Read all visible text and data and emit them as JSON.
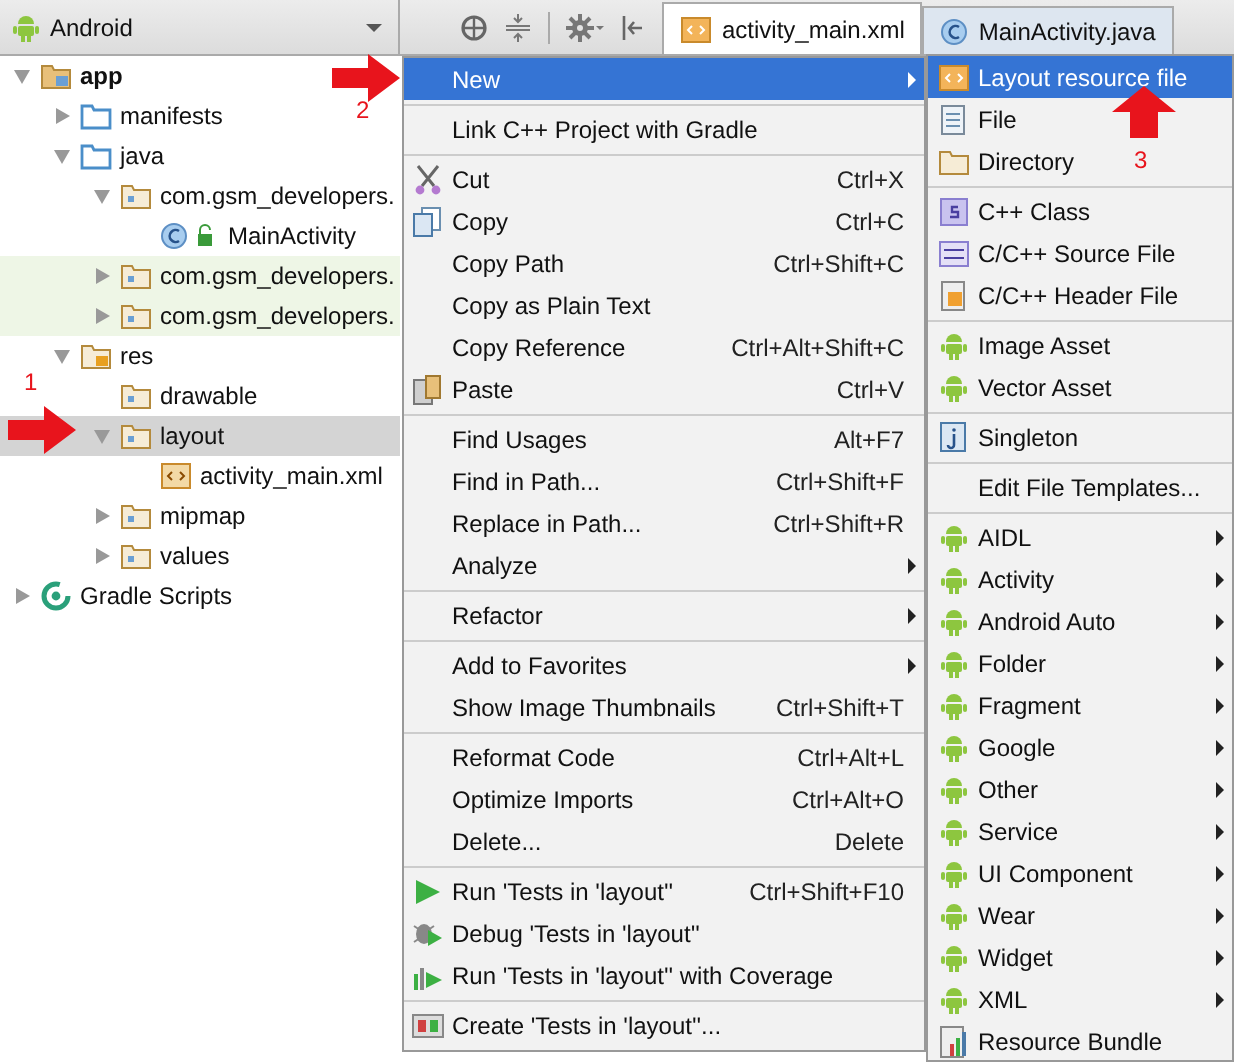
{
  "toolbar": {
    "view_selector": "Android",
    "tabs": [
      {
        "label": "activity_main.xml",
        "kind": "xml",
        "selected": true
      },
      {
        "label": "MainActivity.java",
        "kind": "class",
        "selected": false
      }
    ]
  },
  "project_tree": [
    {
      "label": "app",
      "kind": "module",
      "expanded": true,
      "selected": false,
      "highlighted": false,
      "children": [
        {
          "label": "manifests",
          "kind": "folder",
          "expanded": false,
          "selected": false,
          "highlighted": false
        },
        {
          "label": "java",
          "kind": "folder",
          "expanded": true,
          "selected": false,
          "highlighted": false,
          "children": [
            {
              "label": "com.gsm_developers.",
              "kind": "package",
              "expanded": true,
              "selected": false,
              "highlighted": false,
              "children": [
                {
                  "label": "MainActivity",
                  "kind": "class",
                  "selected": false,
                  "highlighted": false
                }
              ]
            },
            {
              "label": "com.gsm_developers.",
              "kind": "package",
              "expanded": false,
              "selected": false,
              "highlighted": true
            },
            {
              "label": "com.gsm_developers.",
              "kind": "package",
              "expanded": false,
              "selected": false,
              "highlighted": true
            }
          ]
        },
        {
          "label": "res",
          "kind": "res",
          "expanded": true,
          "selected": false,
          "highlighted": false,
          "children": [
            {
              "label": "drawable",
              "kind": "package",
              "selected": false,
              "highlighted": false
            },
            {
              "label": "layout",
              "kind": "package",
              "expanded": true,
              "selected": true,
              "highlighted": false,
              "children": [
                {
                  "label": "activity_main.xml",
                  "kind": "xml",
                  "selected": false,
                  "highlighted": false
                }
              ]
            },
            {
              "label": "mipmap",
              "kind": "package",
              "expanded": false,
              "selected": false,
              "highlighted": false
            },
            {
              "label": "values",
              "kind": "package",
              "expanded": false,
              "selected": false,
              "highlighted": false
            }
          ]
        }
      ]
    },
    {
      "label": "Gradle Scripts",
      "kind": "gradle",
      "expanded": false,
      "selected": false,
      "highlighted": false
    }
  ],
  "context_menu": [
    {
      "kind": "item",
      "label": "New",
      "submenu": true,
      "selected": true
    },
    {
      "kind": "separator"
    },
    {
      "kind": "item",
      "label": "Link C++ Project with Gradle",
      "selected": false
    },
    {
      "kind": "separator"
    },
    {
      "kind": "item",
      "label": "Cut",
      "shortcut": "Ctrl+X",
      "selected": false
    },
    {
      "kind": "item",
      "label": "Copy",
      "shortcut": "Ctrl+C",
      "selected": false
    },
    {
      "kind": "item",
      "label": "Copy Path",
      "shortcut": "Ctrl+Shift+C",
      "selected": false
    },
    {
      "kind": "item",
      "label": "Copy as Plain Text",
      "selected": false
    },
    {
      "kind": "item",
      "label": "Copy Reference",
      "shortcut": "Ctrl+Alt+Shift+C",
      "selected": false
    },
    {
      "kind": "item",
      "label": "Paste",
      "shortcut": "Ctrl+V",
      "selected": false
    },
    {
      "kind": "separator"
    },
    {
      "kind": "item",
      "label": "Find Usages",
      "shortcut": "Alt+F7",
      "selected": false
    },
    {
      "kind": "item",
      "label": "Find in Path...",
      "shortcut": "Ctrl+Shift+F",
      "selected": false
    },
    {
      "kind": "item",
      "label": "Replace in Path...",
      "shortcut": "Ctrl+Shift+R",
      "selected": false
    },
    {
      "kind": "item",
      "label": "Analyze",
      "submenu": true,
      "selected": false
    },
    {
      "kind": "separator"
    },
    {
      "kind": "item",
      "label": "Refactor",
      "submenu": true,
      "selected": false
    },
    {
      "kind": "separator"
    },
    {
      "kind": "item",
      "label": "Add to Favorites",
      "submenu": true,
      "selected": false
    },
    {
      "kind": "item",
      "label": "Show Image Thumbnails",
      "shortcut": "Ctrl+Shift+T",
      "selected": false
    },
    {
      "kind": "separator"
    },
    {
      "kind": "item",
      "label": "Reformat Code",
      "shortcut": "Ctrl+Alt+L",
      "selected": false
    },
    {
      "kind": "item",
      "label": "Optimize Imports",
      "shortcut": "Ctrl+Alt+O",
      "selected": false
    },
    {
      "kind": "item",
      "label": "Delete...",
      "shortcut": "Delete",
      "selected": false
    },
    {
      "kind": "separator"
    },
    {
      "kind": "item",
      "label": "Run 'Tests in 'layout''",
      "shortcut": "Ctrl+Shift+F10",
      "selected": false
    },
    {
      "kind": "item",
      "label": "Debug 'Tests in 'layout''",
      "selected": false
    },
    {
      "kind": "item",
      "label": "Run 'Tests in 'layout'' with Coverage",
      "selected": false
    },
    {
      "kind": "separator"
    },
    {
      "kind": "item",
      "label": "Create 'Tests in 'layout''...",
      "selected": false
    }
  ],
  "new_submenu": [
    {
      "kind": "item",
      "label": "Layout resource file",
      "selected": true
    },
    {
      "kind": "item",
      "label": "File",
      "selected": false
    },
    {
      "kind": "item",
      "label": "Directory",
      "selected": false
    },
    {
      "kind": "separator"
    },
    {
      "kind": "item",
      "label": "C++ Class",
      "selected": false
    },
    {
      "kind": "item",
      "label": "C/C++ Source File",
      "selected": false
    },
    {
      "kind": "item",
      "label": "C/C++ Header File",
      "selected": false
    },
    {
      "kind": "separator"
    },
    {
      "kind": "item",
      "label": "Image Asset",
      "selected": false
    },
    {
      "kind": "item",
      "label": "Vector Asset",
      "selected": false
    },
    {
      "kind": "separator"
    },
    {
      "kind": "item",
      "label": "Singleton",
      "selected": false
    },
    {
      "kind": "separator"
    },
    {
      "kind": "item",
      "label": "Edit File Templates...",
      "selected": false
    },
    {
      "kind": "separator"
    },
    {
      "kind": "item",
      "label": "AIDL",
      "submenu": true,
      "selected": false
    },
    {
      "kind": "item",
      "label": "Activity",
      "submenu": true,
      "selected": false
    },
    {
      "kind": "item",
      "label": "Android Auto",
      "submenu": true,
      "selected": false
    },
    {
      "kind": "item",
      "label": "Folder",
      "submenu": true,
      "selected": false
    },
    {
      "kind": "item",
      "label": "Fragment",
      "submenu": true,
      "selected": false
    },
    {
      "kind": "item",
      "label": "Google",
      "submenu": true,
      "selected": false
    },
    {
      "kind": "item",
      "label": "Other",
      "submenu": true,
      "selected": false
    },
    {
      "kind": "item",
      "label": "Service",
      "submenu": true,
      "selected": false
    },
    {
      "kind": "item",
      "label": "UI Component",
      "submenu": true,
      "selected": false
    },
    {
      "kind": "item",
      "label": "Wear",
      "submenu": true,
      "selected": false
    },
    {
      "kind": "item",
      "label": "Widget",
      "submenu": true,
      "selected": false
    },
    {
      "kind": "item",
      "label": "XML",
      "submenu": true,
      "selected": false
    },
    {
      "kind": "item",
      "label": "Resource Bundle",
      "selected": false
    }
  ],
  "annotations": [
    {
      "label": "1"
    },
    {
      "label": "2"
    },
    {
      "label": "3"
    }
  ]
}
